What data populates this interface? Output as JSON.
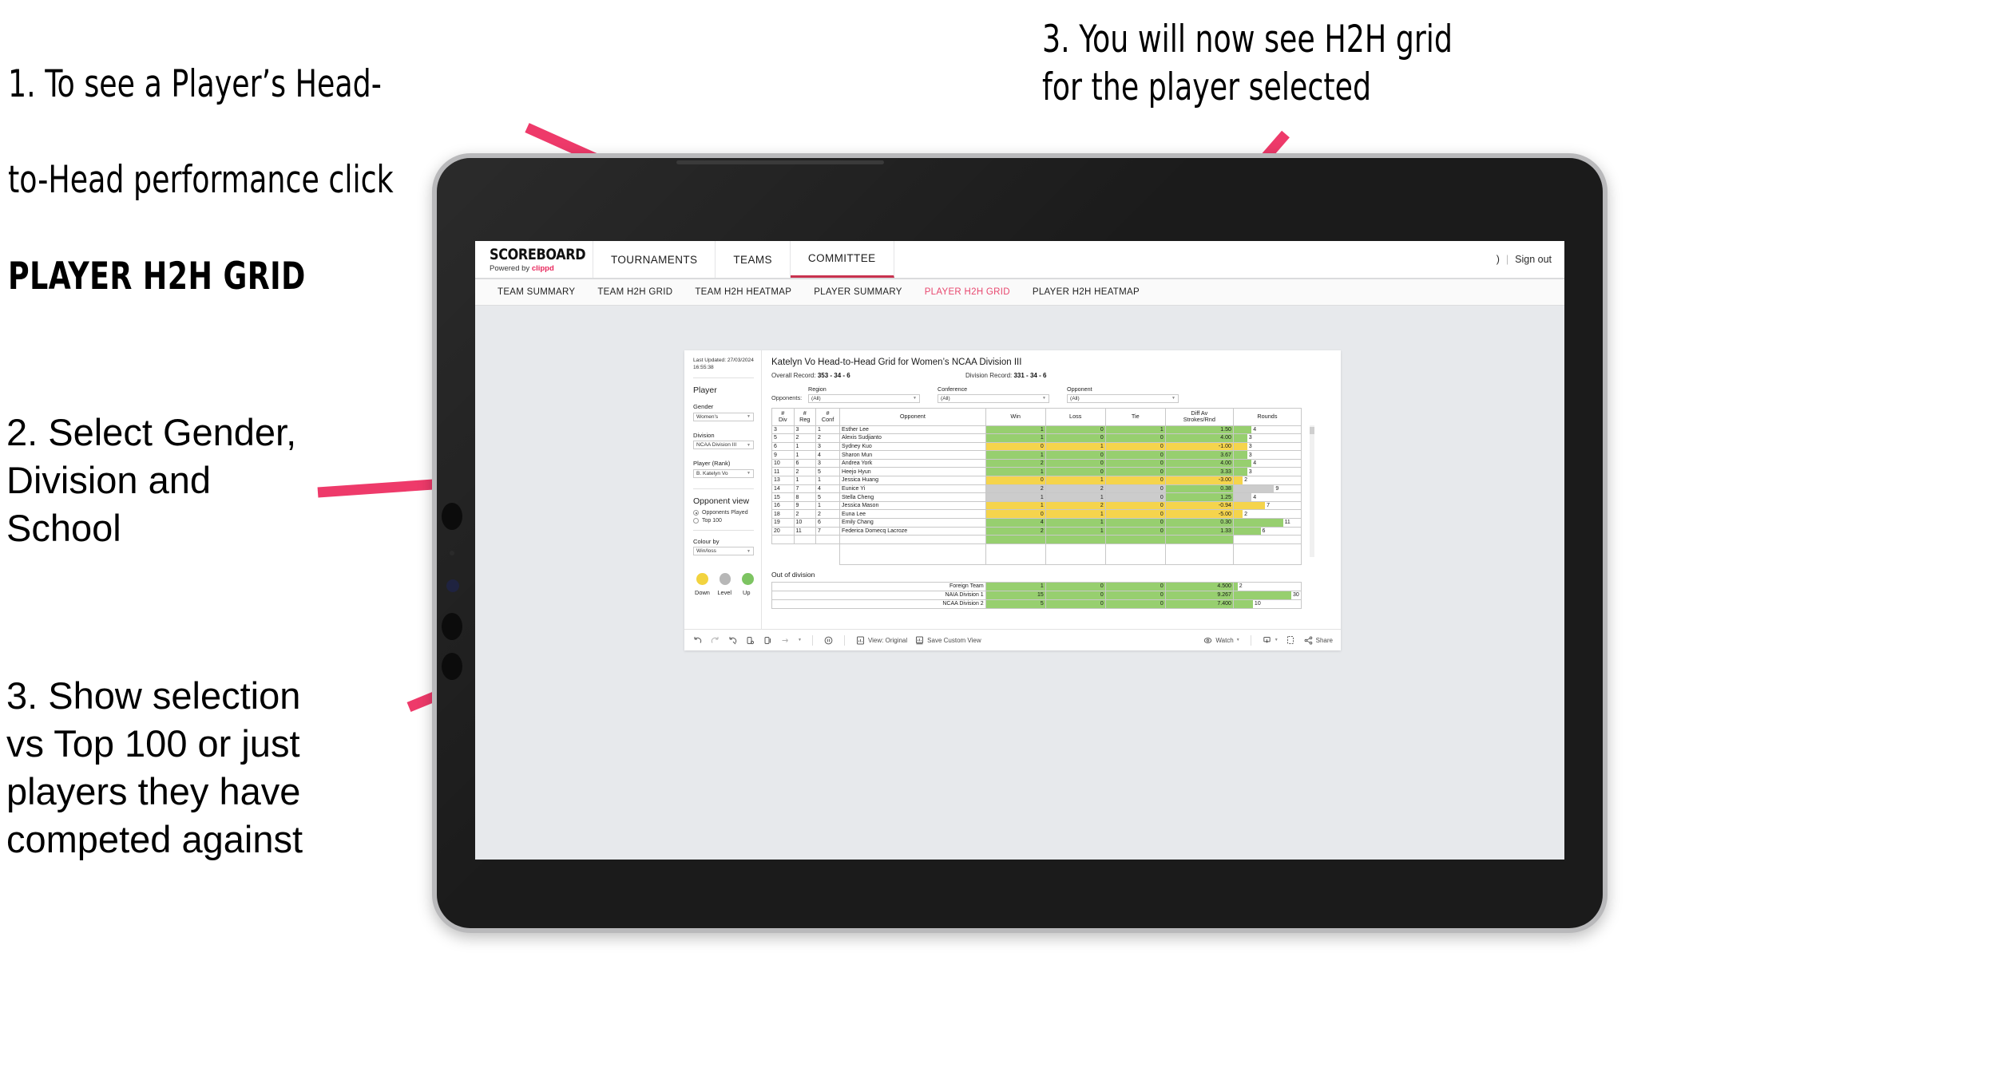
{
  "annotations": [
    {
      "id": "a1",
      "line1": "1. To see a Player’s Head-",
      "line2": "to-Head performance click",
      "bold": "PLAYER H2H GRID"
    },
    {
      "id": "a2",
      "text": "2. Select Gender,\nDivision and\nSchool"
    },
    {
      "id": "a3",
      "text": "3. Show selection\nvs Top 100 or just\nplayers they have\ncompeted against"
    },
    {
      "id": "a4",
      "text": "3. You will now see H2H grid\nfor the player selected"
    }
  ],
  "colors": {
    "accent_pink": "#e8486f",
    "arrow_pink": "#ee3a6a",
    "up_green": "#7dc462",
    "down_yellow": "#f2d33f",
    "level_grey": "#b7b7b7",
    "cell_green": "#97cf6f",
    "cell_yellow": "#f5d44c",
    "cell_grey": "#cccccc"
  },
  "app": {
    "logo": {
      "main": "SCOREBOARD",
      "sub_prefix": "Powered by ",
      "sub_brand": "clippd"
    },
    "topnav": [
      {
        "label": "TOURNAMENTS",
        "active": false
      },
      {
        "label": "TEAMS",
        "active": false
      },
      {
        "label": "COMMITTEE",
        "active": true
      }
    ],
    "header_right": {
      "user": ")",
      "separator": "|",
      "signout": "Sign out"
    },
    "subnav": [
      {
        "label": "TEAM SUMMARY",
        "active": false
      },
      {
        "label": "TEAM H2H GRID",
        "active": false
      },
      {
        "label": "TEAM H2H HEATMAP",
        "active": false
      },
      {
        "label": "PLAYER SUMMARY",
        "active": false
      },
      {
        "label": "PLAYER H2H GRID",
        "active": true
      },
      {
        "label": "PLAYER H2H HEATMAP",
        "active": false
      }
    ]
  },
  "filters": {
    "last_updated": "Last Updated: 27/03/2024\n16:55:38",
    "section_title": "Player",
    "gender": {
      "label": "Gender",
      "value": "Women's"
    },
    "division": {
      "label": "Division",
      "value": "NCAA Division III"
    },
    "player": {
      "label": "Player (Rank)",
      "value": "B. Katelyn Vo"
    },
    "opponent_view": {
      "title": "Opponent view",
      "options": [
        {
          "label": "Opponents Played",
          "selected": true
        },
        {
          "label": "Top 100",
          "selected": false
        }
      ]
    },
    "colour_by": {
      "label": "Colour by",
      "value": "Win/loss"
    },
    "legend": [
      {
        "label": "Down",
        "color": "#f2d33f"
      },
      {
        "label": "Level",
        "color": "#b7b7b7"
      },
      {
        "label": "Up",
        "color": "#7dc462"
      }
    ]
  },
  "main": {
    "title": "Katelyn Vo Head-to-Head Grid for Women’s NCAA Division III",
    "overall_record": {
      "label": "Overall Record:",
      "value": "353 -  34 - 6"
    },
    "division_record": {
      "label": "Division Record:",
      "value": "331 -  34 - 6"
    },
    "opponents_label": "Opponents:",
    "opponent_filters": [
      {
        "label": "Region",
        "value": "(All)"
      },
      {
        "label": "Conference",
        "value": "(All)"
      },
      {
        "label": "Opponent",
        "value": "(All)"
      }
    ],
    "table_headers": [
      "#\nDiv",
      "#\nReg",
      "#\nConf",
      "Opponent",
      "Win",
      "Loss",
      "Tie",
      "Diff Av\nStrokes/Rnd",
      "Rounds"
    ],
    "rows": [
      {
        "div": "3",
        "reg": "3",
        "conf": "1",
        "opponent": "Esther Lee",
        "win": "1",
        "loss": "0",
        "tie": "1",
        "diff": "1.50",
        "rounds": "4",
        "state": "win"
      },
      {
        "div": "5",
        "reg": "2",
        "conf": "2",
        "opponent": "Alexis Sudjianto",
        "win": "1",
        "loss": "0",
        "tie": "0",
        "diff": "4.00",
        "rounds": "3",
        "state": "win"
      },
      {
        "div": "6",
        "reg": "1",
        "conf": "3",
        "opponent": "Sydney Kuo",
        "win": "0",
        "loss": "1",
        "tie": "0",
        "diff": "-1.00",
        "rounds": "3",
        "state": "loss"
      },
      {
        "div": "9",
        "reg": "1",
        "conf": "4",
        "opponent": "Sharon Mun",
        "win": "1",
        "loss": "0",
        "tie": "0",
        "diff": "3.67",
        "rounds": "3",
        "state": "win"
      },
      {
        "div": "10",
        "reg": "6",
        "conf": "3",
        "opponent": "Andrea York",
        "win": "2",
        "loss": "0",
        "tie": "0",
        "diff": "4.00",
        "rounds": "4",
        "state": "win"
      },
      {
        "div": "11",
        "reg": "2",
        "conf": "5",
        "opponent": "Heejo Hyun",
        "win": "1",
        "loss": "0",
        "tie": "0",
        "diff": "3.33",
        "rounds": "3",
        "state": "win"
      },
      {
        "div": "13",
        "reg": "1",
        "conf": "1",
        "opponent": "Jessica Huang",
        "win": "0",
        "loss": "1",
        "tie": "0",
        "diff": "-3.00",
        "rounds": "2",
        "state": "loss"
      },
      {
        "div": "14",
        "reg": "7",
        "conf": "4",
        "opponent": "Eunice Yi",
        "win": "2",
        "loss": "2",
        "tie": "0",
        "diff": "0.38",
        "rounds": "9",
        "state": "level",
        "diff_green": true
      },
      {
        "div": "15",
        "reg": "8",
        "conf": "5",
        "opponent": "Stella Cheng",
        "win": "1",
        "loss": "1",
        "tie": "0",
        "diff": "1.25",
        "rounds": "4",
        "state": "level",
        "diff_green": true
      },
      {
        "div": "16",
        "reg": "9",
        "conf": "1",
        "opponent": "Jessica Mason",
        "win": "1",
        "loss": "2",
        "tie": "0",
        "diff": "-0.94",
        "rounds": "7",
        "state": "loss"
      },
      {
        "div": "18",
        "reg": "2",
        "conf": "2",
        "opponent": "Euna Lee",
        "win": "0",
        "loss": "1",
        "tie": "0",
        "diff": "-5.00",
        "rounds": "2",
        "state": "loss"
      },
      {
        "div": "19",
        "reg": "10",
        "conf": "6",
        "opponent": "Emily Chang",
        "win": "4",
        "loss": "1",
        "tie": "0",
        "diff": "0.30",
        "rounds": "11",
        "state": "win"
      },
      {
        "div": "20",
        "reg": "11",
        "conf": "7",
        "opponent": "Federica Domecq Lacroze",
        "win": "2",
        "loss": "1",
        "tie": "0",
        "diff": "1.33",
        "rounds": "6",
        "state": "win"
      }
    ],
    "out_of_division": {
      "title": "Out of division",
      "rows": [
        {
          "name": "Foreign Team",
          "win": "1",
          "loss": "0",
          "tie": "0",
          "diff": "4.500",
          "rounds": "2",
          "state": "win"
        },
        {
          "name": "NAIA Division 1",
          "win": "15",
          "loss": "0",
          "tie": "0",
          "diff": "9.267",
          "rounds": "30",
          "state": "win"
        },
        {
          "name": "NCAA Division 2",
          "win": "5",
          "loss": "0",
          "tie": "0",
          "diff": "7.400",
          "rounds": "10",
          "state": "win"
        }
      ]
    }
  },
  "toolbar": {
    "view_original": "View: Original",
    "save_custom_view": "Save Custom View",
    "watch": "Watch",
    "share": "Share"
  },
  "chart_data": {
    "type": "table",
    "title": "Katelyn Vo Head-to-Head Grid for Women’s NCAA Division III",
    "columns": [
      "# Div",
      "# Reg",
      "# Conf",
      "Opponent",
      "Win",
      "Loss",
      "Tie",
      "Diff Av Strokes/Rnd",
      "Rounds"
    ],
    "rounds_bar_max": 15,
    "rows": [
      [
        "3",
        "3",
        "1",
        "Esther Lee",
        1,
        0,
        1,
        1.5,
        4
      ],
      [
        "5",
        "2",
        "2",
        "Alexis Sudjianto",
        1,
        0,
        0,
        4.0,
        3
      ],
      [
        "6",
        "1",
        "3",
        "Sydney Kuo",
        0,
        1,
        0,
        -1.0,
        3
      ],
      [
        "9",
        "1",
        "4",
        "Sharon Mun",
        1,
        0,
        0,
        3.67,
        3
      ],
      [
        "10",
        "6",
        "3",
        "Andrea York",
        2,
        0,
        0,
        4.0,
        4
      ],
      [
        "11",
        "2",
        "5",
        "Heejo Hyun",
        1,
        0,
        0,
        3.33,
        3
      ],
      [
        "13",
        "1",
        "1",
        "Jessica Huang",
        0,
        1,
        0,
        -3.0,
        2
      ],
      [
        "14",
        "7",
        "4",
        "Eunice Yi",
        2,
        2,
        0,
        0.38,
        9
      ],
      [
        "15",
        "8",
        "5",
        "Stella Cheng",
        1,
        1,
        0,
        1.25,
        4
      ],
      [
        "16",
        "9",
        "1",
        "Jessica Mason",
        1,
        2,
        0,
        -0.94,
        7
      ],
      [
        "18",
        "2",
        "2",
        "Euna Lee",
        0,
        1,
        0,
        -5.0,
        2
      ],
      [
        "19",
        "10",
        "6",
        "Emily Chang",
        4,
        1,
        0,
        0.3,
        11
      ],
      [
        "20",
        "11",
        "7",
        "Federica Domecq Lacroze",
        2,
        1,
        0,
        1.33,
        6
      ]
    ],
    "out_of_division_rows": [
      [
        "Foreign Team",
        1,
        0,
        0,
        4.5,
        2
      ],
      [
        "NAIA Division 1",
        15,
        0,
        0,
        9.267,
        30
      ],
      [
        "NCAA Division 2",
        5,
        0,
        0,
        7.4,
        10
      ]
    ]
  }
}
